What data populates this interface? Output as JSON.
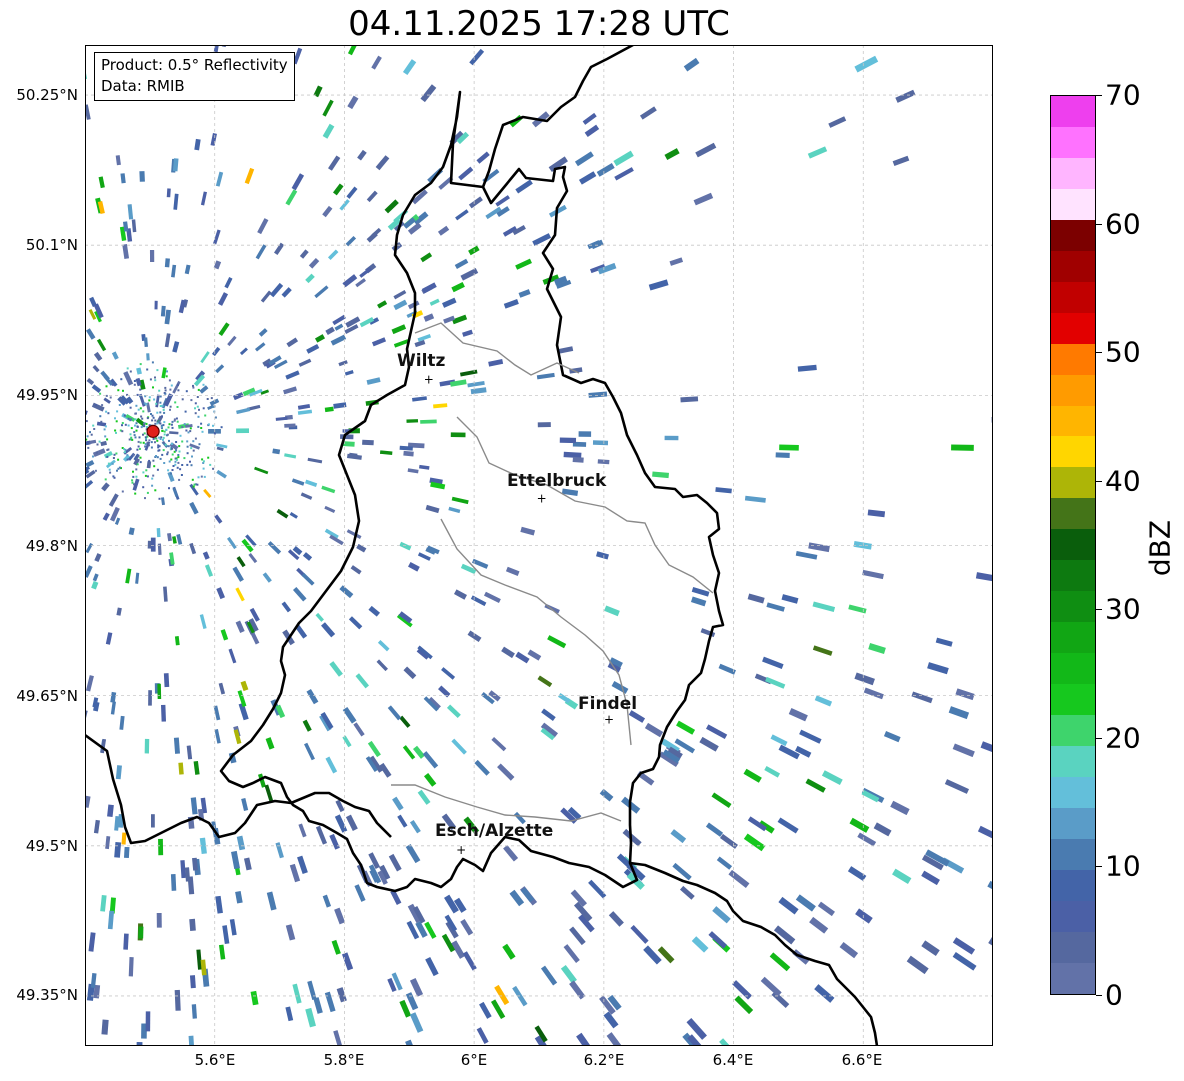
{
  "title": "04.11.2025 17:28 UTC",
  "info": {
    "product": "Product: 0.5° Reflectivity",
    "data": "Data: RMIB"
  },
  "axes": {
    "lat_ticks": [
      "50.25°N",
      "50.1°N",
      "49.95°N",
      "49.8°N",
      "49.65°N",
      "49.5°N",
      "49.35°N"
    ],
    "lon_ticks": [
      "5.6°E",
      "5.8°E",
      "6°E",
      "6.2°E",
      "6.4°E",
      "6.6°E"
    ],
    "lat_values": [
      50.25,
      50.1,
      49.95,
      49.8,
      49.65,
      49.5,
      49.35
    ],
    "lon_values": [
      5.6,
      5.8,
      6.0,
      6.2,
      6.4,
      6.6
    ],
    "lon_range": [
      5.4,
      6.8
    ],
    "lat_range": [
      49.3,
      50.3
    ],
    "grid": "dashed light gray"
  },
  "cities": [
    {
      "name": "Wiltz",
      "lon": 5.93,
      "lat": 49.966
    },
    {
      "name": "Ettelbruck",
      "lon": 6.104,
      "lat": 49.847
    },
    {
      "name": "Findel",
      "lon": 6.208,
      "lat": 49.626
    },
    {
      "name": "Esch/Alzette",
      "lon": 5.98,
      "lat": 49.496
    }
  ],
  "radar_site": {
    "lon": 5.505,
    "lat": 49.914,
    "color": "#e0201a"
  },
  "colorbar": {
    "label": "dBZ",
    "min": 0,
    "max": 70,
    "ticks": [
      "0",
      "10",
      "20",
      "30",
      "40",
      "50",
      "60",
      "70"
    ],
    "colors": [
      "#6272a8",
      "#55689f",
      "#4b60a6",
      "#4364a8",
      "#4a7bb0",
      "#5a9cc8",
      "#63bfda",
      "#5ad3c0",
      "#3ed46c",
      "#16c81e",
      "#12b818",
      "#11a614",
      "#0f8e12",
      "#0d7a10",
      "#0a5e0c",
      "#447418",
      "#adb507",
      "#ffd600",
      "#ffb500",
      "#ff9b00",
      "#ff7a00",
      "#e20000",
      "#c10000",
      "#a00000",
      "#7c0000",
      "#ffe3ff",
      "#ffb5ff",
      "#ff72ff",
      "#ee3fee"
    ]
  }
}
